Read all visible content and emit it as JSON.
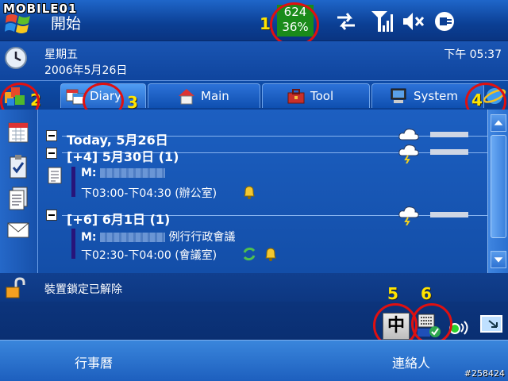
{
  "watermark": "MOBILE01",
  "titlebar": {
    "start_label": "開始",
    "memory": {
      "value_top": "624",
      "value_bottom": "36%"
    }
  },
  "annotations": [
    "1",
    "2",
    "3",
    "4",
    "5",
    "6"
  ],
  "datebar": {
    "weekday": "星期五",
    "date": "2006年5月26日",
    "time": "下午 05:37"
  },
  "tabs": [
    {
      "label": "Diary",
      "icon": "calendar-icon",
      "active": true
    },
    {
      "label": "Main",
      "icon": "home-icon",
      "active": false
    },
    {
      "label": "Tool",
      "icon": "toolbox-icon",
      "active": false
    },
    {
      "label": "System",
      "icon": "computer-icon",
      "active": false
    }
  ],
  "diary": {
    "days": [
      {
        "heading": "Today, 5月26日",
        "weather": "cloud-lightning-icon"
      },
      {
        "heading": "[+4] 5月30日 (1)",
        "weather": "cloud-lightning-icon",
        "appointment": {
          "subject_prefix": "M:",
          "time": "下03:00-下04:30",
          "location": "(辦公室)"
        }
      },
      {
        "heading": "[+6] 6月1日 (1)",
        "weather": "cloud-lightning-icon",
        "appointment": {
          "subject_prefix": "M:",
          "subject": "例行行政會議",
          "time": "下02:30-下04:00",
          "location": "(會議室)"
        }
      }
    ]
  },
  "lockbar": {
    "status": "裝置鎖定已解除"
  },
  "tray": {
    "ime_label": "中"
  },
  "softkeys": {
    "left": "行事曆",
    "right": "連絡人"
  },
  "image_id": "#258424",
  "colors": {
    "annotation_ring": "#e01010",
    "annotation_number": "#ffe400",
    "memory_box": "#1a8b1a"
  }
}
